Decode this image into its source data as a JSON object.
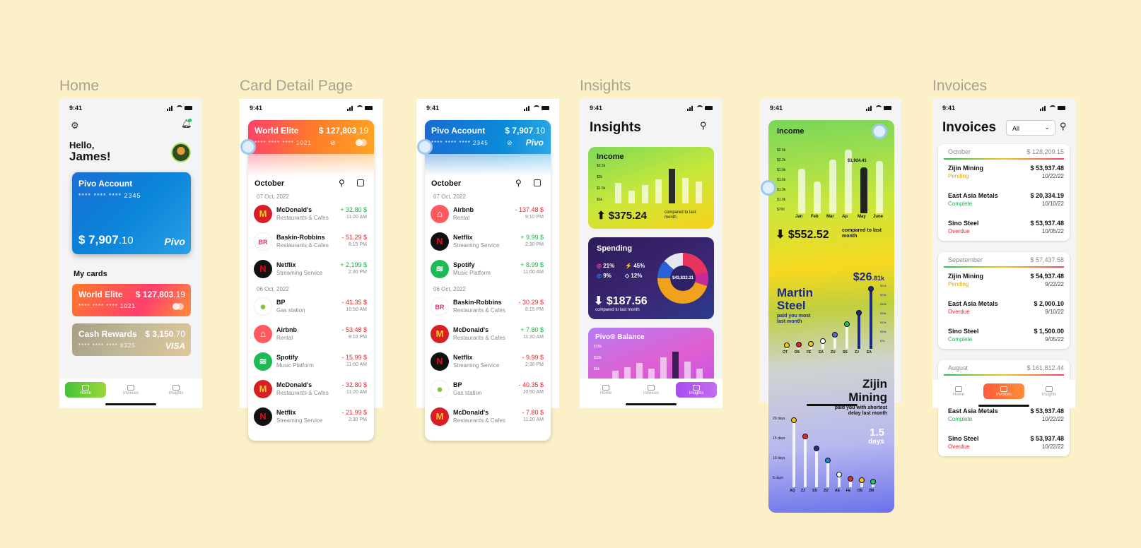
{
  "sections": {
    "home": "Home",
    "card_detail": "Card Detail Page",
    "insights": "Insights",
    "invoices": "Invoices"
  },
  "status_time": "9:41",
  "home": {
    "greeting_line1": "Hello,",
    "greeting_line2": "James!",
    "main_card": {
      "title": "Pivo Account",
      "number": "**** **** **** 2345",
      "amount_main": "$ 7,907",
      "amount_cents": ".10",
      "brand": "Pivo"
    },
    "my_cards_label": "My cards",
    "cards": [
      {
        "title": "World Elite",
        "amount_main": "$ 127,803",
        "amount_cents": ".19",
        "number": "**** **** **** 1021"
      },
      {
        "title": "Cash Rewards",
        "amount_main": "$ 3,150",
        "amount_cents": ".70",
        "number": "**** **** **** 8325",
        "brand": "VISA"
      }
    ],
    "nav": [
      "Home",
      "Invoices",
      "Insights"
    ]
  },
  "card_detail_1": {
    "card_title": "World Elite",
    "card_amount_main": "$ 127,803",
    "card_amount_cents": ".19",
    "card_number": "**** **** **** 1021",
    "month": "October",
    "groups": [
      {
        "date": "07 Oct, 2022",
        "items": [
          {
            "name": "McDonald's",
            "category": "Restaurants & Cafes",
            "amount": "+ 32.80 $",
            "time": "11:20 AM",
            "sign": "pos",
            "logo": "M",
            "logo_bg": "#d81f26",
            "logo_fg": "#ffc72c"
          },
          {
            "name": "Baskin-Robbins",
            "category": "Restaurants & Cafes",
            "amount": "- 51.29 $",
            "time": "8:15 PM",
            "sign": "neg",
            "logo": "BR",
            "logo_bg": "#ffffff",
            "logo_fg": "#d5336e"
          },
          {
            "name": "Netflix",
            "category": "Streaming Service",
            "amount": "+ 2,199 $",
            "time": "2:30 PM",
            "sign": "pos",
            "logo": "N",
            "logo_bg": "#111111",
            "logo_fg": "#e50914"
          }
        ]
      },
      {
        "date": "06 Oct, 2022",
        "items": [
          {
            "name": "BP",
            "category": "Gas station",
            "amount": "- 41.35 $",
            "time": "10:50 AM",
            "sign": "neg",
            "logo": "✺",
            "logo_bg": "#ffffff",
            "logo_fg": "#7ac143"
          },
          {
            "name": "Airbnb",
            "category": "Rental",
            "amount": "- 53.48 $",
            "time": "9:10 PM",
            "sign": "neg",
            "logo": "⌂",
            "logo_bg": "#ff5a5f",
            "logo_fg": "#ffffff"
          },
          {
            "name": "Spotify",
            "category": "Music Platform",
            "amount": "- 15.99 $",
            "time": "11:00 AM",
            "sign": "neg",
            "logo": "≋",
            "logo_bg": "#1db954",
            "logo_fg": "#ffffff"
          },
          {
            "name": "McDonald's",
            "category": "Restaurants & Cafes",
            "amount": "- 32.80 $",
            "time": "11:20 AM",
            "sign": "neg",
            "logo": "M",
            "logo_bg": "#d81f26",
            "logo_fg": "#ffc72c"
          },
          {
            "name": "Netflix",
            "category": "Streaming Service",
            "amount": "- 21.99 $",
            "time": "2:30 PM",
            "sign": "neg",
            "logo": "N",
            "logo_bg": "#111111",
            "logo_fg": "#e50914"
          }
        ]
      }
    ]
  },
  "card_detail_2": {
    "card_title": "Pivo Account",
    "card_amount_main": "$ 7,907",
    "card_amount_cents": ".10",
    "card_number": "**** **** **** 2345",
    "brand": "Pivo",
    "month": "October",
    "groups": [
      {
        "date": "07 Oct, 2022",
        "items": [
          {
            "name": "Airbnb",
            "category": "Rental",
            "amount": "- 137.48 $",
            "time": "9:10 PM",
            "sign": "neg",
            "logo": "⌂",
            "logo_bg": "#ff5a5f",
            "logo_fg": "#ffffff"
          },
          {
            "name": "Netflix",
            "category": "Streaming Service",
            "amount": "+ 9.99 $",
            "time": "2:30 PM",
            "sign": "pos",
            "logo": "N",
            "logo_bg": "#111111",
            "logo_fg": "#e50914"
          },
          {
            "name": "Spotify",
            "category": "Music Platform",
            "amount": "+ 8.99 $",
            "time": "11:00 AM",
            "sign": "pos",
            "logo": "≋",
            "logo_bg": "#1db954",
            "logo_fg": "#ffffff"
          }
        ]
      },
      {
        "date": "06 Oct, 2022",
        "items": [
          {
            "name": "Baskin-Robbins",
            "category": "Restaurants & Cafes",
            "amount": "- 30.29 $",
            "time": "8:15 PM",
            "sign": "neg",
            "logo": "BR",
            "logo_bg": "#ffffff",
            "logo_fg": "#d5336e"
          },
          {
            "name": "McDonald's",
            "category": "Restaurants & Cafes",
            "amount": "+ 7.80 $",
            "time": "11:20 AM",
            "sign": "pos",
            "logo": "M",
            "logo_bg": "#d81f26",
            "logo_fg": "#ffc72c"
          },
          {
            "name": "Netflix",
            "category": "Streaming Service",
            "amount": "- 9.99 $",
            "time": "2:30 PM",
            "sign": "neg",
            "logo": "N",
            "logo_bg": "#111111",
            "logo_fg": "#e50914"
          },
          {
            "name": "BP",
            "category": "Gas station",
            "amount": "- 40.35 $",
            "time": "10:50 AM",
            "sign": "neg",
            "logo": "✺",
            "logo_bg": "#ffffff",
            "logo_fg": "#7ac143"
          },
          {
            "name": "McDonald's",
            "category": "Restaurants & Cafes",
            "amount": "- 7.80 $",
            "time": "11:20 AM",
            "sign": "neg",
            "logo": "M",
            "logo_bg": "#d81f26",
            "logo_fg": "#ffc72c"
          }
        ]
      }
    ]
  },
  "insights": {
    "title": "Insights",
    "income": {
      "label": "Income",
      "amount": "$375.24",
      "compare": "compared to last month",
      "y_ticks": [
        "$2.5k",
        "$2k",
        "$1.5k",
        "$1k"
      ]
    },
    "spending": {
      "label": "Spending",
      "amount": "$187.56",
      "compare": "compared to last month",
      "center": "$43,832.31",
      "stats": [
        "21%",
        "45%",
        "9%",
        "12%"
      ]
    },
    "balance": {
      "label": "Pivo® Balance",
      "y_ticks": [
        "$15k",
        "$10k",
        "$5k"
      ]
    },
    "nav": [
      "Home",
      "Invoices",
      "Insights"
    ]
  },
  "insights_detail": {
    "income_label": "Income",
    "y_ticks": [
      "$2.5k",
      "$2.2k",
      "$1.9k",
      "$1.6k",
      "$1.3k",
      "$1.0k",
      "$700"
    ],
    "x_labels": [
      "Jan",
      "Feb",
      "Mar",
      "Ap",
      "May",
      "June"
    ],
    "peak_label": "$1,924.41",
    "amount": "$552.52",
    "compare": "compared to last month",
    "steel_name": "Martin Steel",
    "steel_sub": "paid you most last month",
    "steel_amount": "$26",
    "steel_unit": ".81k",
    "steel_ticks": [
      "$21k",
      "$23k",
      "$19k",
      "$16k",
      "$13k",
      "$10k",
      "$7k"
    ],
    "steel_x": [
      "OT",
      "DS",
      "FE",
      "EA",
      "ZU",
      "SS",
      "ZJ",
      "EA"
    ],
    "zijin_name": "Zijin Mining",
    "zijin_sub": "paid you with shortest delay last month",
    "zijin_days": "1.5",
    "zijin_days_unit": "days",
    "delay_ticks": [
      "20 days",
      "15 days",
      "10 days",
      "5 days"
    ],
    "delay_x": [
      "AQ",
      "ZJ",
      "SS",
      "ZU",
      "AE",
      "FE",
      "DS",
      "ZM"
    ]
  },
  "invoices": {
    "title": "Invoices",
    "filter": "All",
    "groups": [
      {
        "month": "October",
        "total": "$ 128,209.15",
        "rows": [
          {
            "name": "Zijin Mining",
            "status": "Pending",
            "amount": "$ 53,937.48",
            "date": "10/22/22"
          },
          {
            "name": "East Asia Metals",
            "status": "Complete",
            "amount": "$ 20,334.19",
            "date": "10/10/22"
          },
          {
            "name": "Sino Steel",
            "status": "Overdue",
            "amount": "$ 53,937.48",
            "date": "10/05/22"
          }
        ]
      },
      {
        "month": "Sepetember",
        "total": "$ 57,437.58",
        "rows": [
          {
            "name": "Zijin Mining",
            "status": "Pending",
            "amount": "$ 54,937.48",
            "date": "9/22/22"
          },
          {
            "name": "East Asia Metals",
            "status": "Overdue",
            "amount": "$ 2,000.10",
            "date": "9/10/22"
          },
          {
            "name": "Sino Steel",
            "status": "Complete",
            "amount": "$ 1,500.00",
            "date": "9/05/22"
          }
        ]
      },
      {
        "month": "August",
        "total": "$ 161,812.44",
        "rows": [
          {
            "name": "East Asia Metals",
            "status": "Complete",
            "amount": "$ 53,937.48",
            "date": "10/22/22"
          },
          {
            "name": "Sino Steel",
            "status": "Overdue",
            "amount": "$ 53,937.48",
            "date": "10/22/22"
          }
        ]
      }
    ],
    "nav": [
      "Home",
      "Invoices",
      "Insights"
    ]
  }
}
